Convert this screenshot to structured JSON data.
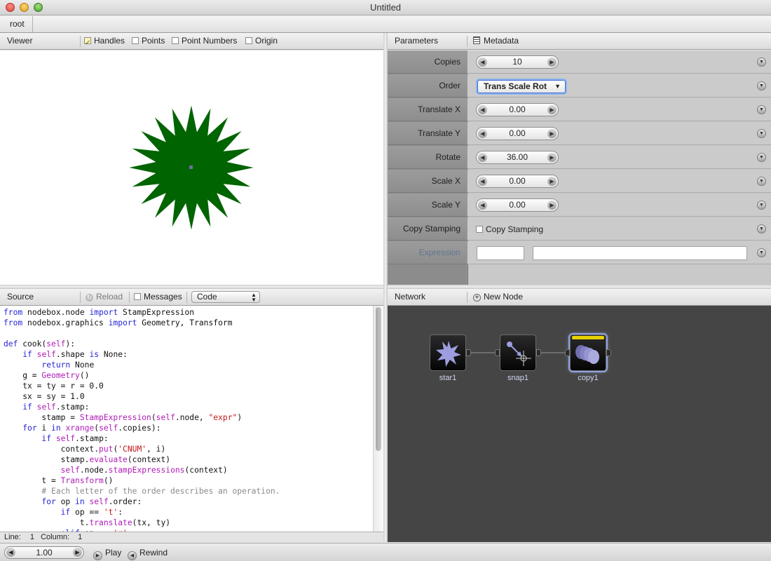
{
  "window": {
    "title": "Untitled"
  },
  "breadcrumb": {
    "root": "root"
  },
  "viewer": {
    "title": "Viewer",
    "options": [
      {
        "label": "Handles",
        "checked": true
      },
      {
        "label": "Points",
        "checked": false
      },
      {
        "label": "Point Numbers",
        "checked": false
      },
      {
        "label": "Origin",
        "checked": false
      }
    ]
  },
  "parameters": {
    "tab_parameters": "Parameters",
    "tab_metadata": "Metadata",
    "rows": {
      "copies": {
        "label": "Copies",
        "value": "10"
      },
      "order": {
        "label": "Order",
        "value": "Trans Scale Rot"
      },
      "translate_x": {
        "label": "Translate X",
        "value": "0.00"
      },
      "translate_y": {
        "label": "Translate Y",
        "value": "0.00"
      },
      "rotate": {
        "label": "Rotate",
        "value": "36.00"
      },
      "scale_x": {
        "label": "Scale X",
        "value": "0.00"
      },
      "scale_y": {
        "label": "Scale Y",
        "value": "0.00"
      },
      "copy_stamping": {
        "label": "Copy Stamping",
        "checkbox_label": "Copy Stamping",
        "checked": false
      },
      "expression": {
        "label": "Expression",
        "value_short": "",
        "value_long": ""
      }
    }
  },
  "source": {
    "title": "Source",
    "reload": "Reload",
    "messages": "Messages",
    "mode": "Code",
    "status_line_label": "Line:",
    "status_line_value": "1",
    "status_col_label": "Column:",
    "status_col_value": "1"
  },
  "network": {
    "title": "Network",
    "new_node": "New Node",
    "nodes": [
      {
        "name": "star1",
        "icon": "star-icon"
      },
      {
        "name": "snap1",
        "icon": "snap-icon"
      },
      {
        "name": "copy1",
        "icon": "copy-icon",
        "rendered": true
      }
    ]
  },
  "bottom": {
    "frame": "1.00",
    "play": "Play",
    "rewind": "Rewind"
  },
  "colors": {
    "shape_fill": "#006400",
    "panel_bg": "#454545",
    "render_flag": "#e6d200"
  }
}
